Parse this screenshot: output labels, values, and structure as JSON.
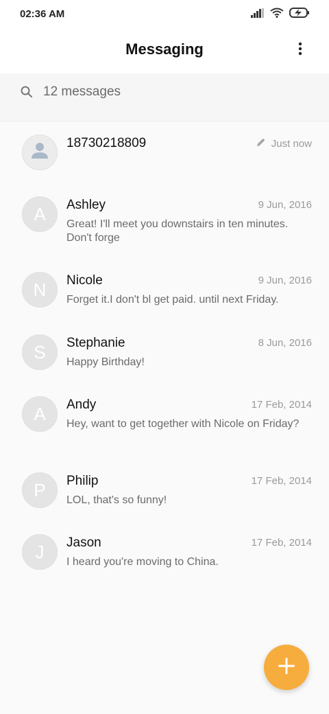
{
  "status": {
    "time": "02:36 AM",
    "icons": [
      "signal-icon",
      "wifi-icon",
      "battery-charging-icon"
    ]
  },
  "header": {
    "title": "Messaging",
    "menu_icon": "more-vert-icon"
  },
  "search": {
    "text": "12 messages",
    "icon": "search-icon"
  },
  "conversations": [
    {
      "initial": "",
      "name": "18730218809",
      "date": "Just now",
      "snippet": "",
      "draft": true
    },
    {
      "initial": "A",
      "name": "Ashley",
      "date": "9 Jun, 2016",
      "snippet": "Great! I'll meet you downstairs in ten minutes. Don't forge"
    },
    {
      "initial": "N",
      "name": "Nicole",
      "date": "9 Jun, 2016",
      "snippet": "Forget it.I don't bl get paid. until next Friday."
    },
    {
      "initial": "S",
      "name": "Stephanie",
      "date": "8 Jun, 2016",
      "snippet": "Happy Birthday!"
    },
    {
      "initial": "A",
      "name": "Andy",
      "date": "17 Feb, 2014",
      "snippet": "Hey, want to get together with Nicole on Friday?"
    },
    {
      "initial": "P",
      "name": "Philip",
      "date": "17 Feb, 2014",
      "snippet": "LOL, that's so funny!"
    },
    {
      "initial": "J",
      "name": "Jason",
      "date": "17 Feb, 2014",
      "snippet": "I heard you're moving to China."
    }
  ],
  "fab": {
    "icon": "plus-icon"
  },
  "colors": {
    "accent": "#f6ad3d",
    "avatar_bg": "#e4e4e4",
    "secondary_text": "#9a9a9a"
  }
}
